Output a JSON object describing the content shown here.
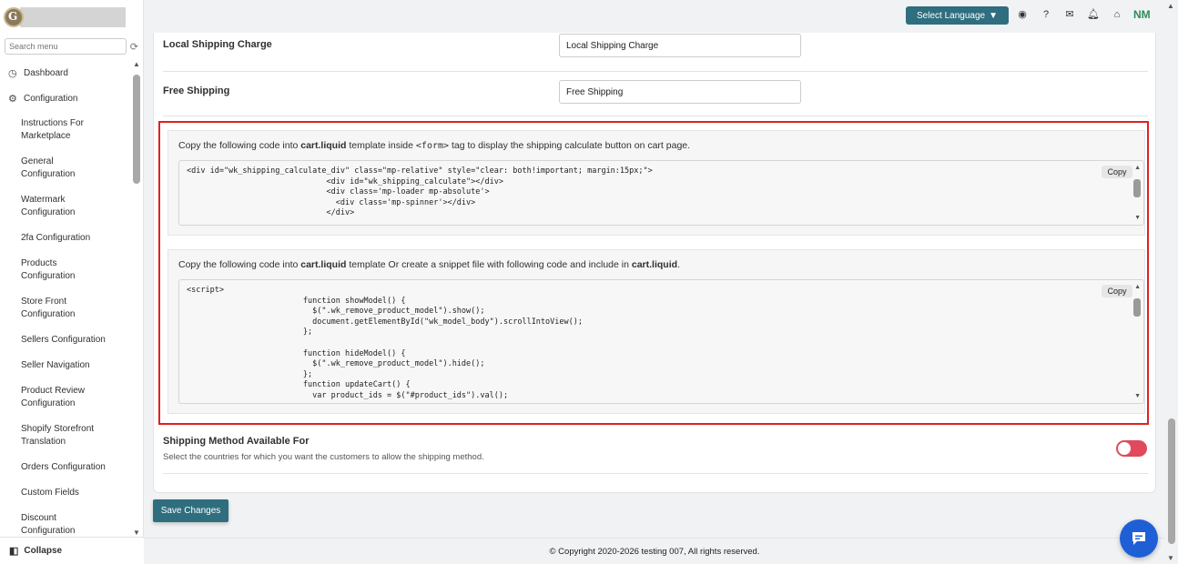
{
  "sidebar": {
    "search_placeholder": "Search menu",
    "top_items": [
      {
        "label": "Dashboard",
        "icon": "dashboard-icon"
      },
      {
        "label": "Configuration",
        "icon": "gear-icon"
      }
    ],
    "sub_items": [
      "Instructions For Marketplace",
      "General Configuration",
      "Watermark Configuration",
      "2fa Configuration",
      "Products Configuration",
      "Store Front Configuration",
      "Sellers Configuration",
      "Seller Navigation",
      "Product Review Configuration",
      "Shopify Storefront Translation",
      "Orders Configuration",
      "Custom Fields",
      "Discount Configuration"
    ],
    "collapse_label": "Collapse"
  },
  "topbar": {
    "language_label": "Select Language",
    "initials": "NM"
  },
  "form": {
    "local_shipping": {
      "label": "Local Shipping Charge",
      "value": "Local Shipping Charge"
    },
    "free_shipping": {
      "label": "Free Shipping",
      "value": "Free Shipping"
    },
    "block1": {
      "desc_pre": "Copy the following code into ",
      "desc_file": "cart.liquid",
      "desc_mid": " template inside ",
      "desc_tag": "<form>",
      "desc_post": " tag to display the shipping calculate button on cart page.",
      "code": "<div id=\"wk_shipping_calculate_div\" class=\"mp-relative\" style=\"clear: both!important; margin:15px;\">\n                              <div id=\"wk_shipping_calculate\"></div>\n                              <div class='mp-loader mp-absolute'>\n                                <div class='mp-spinner'></div>\n                              </div>",
      "copy_label": "Copy"
    },
    "block2": {
      "desc_pre": "Copy the following code into ",
      "desc_file": "cart.liquid",
      "desc_mid": " template Or create a snippet file with following code and include in ",
      "desc_file2": "cart.liquid",
      "desc_post": ".",
      "code": "<script>\n                         function showModel() {\n                           $(\".wk_remove_product_model\").show();\n                           document.getElementById(\"wk_model_body\").scrollIntoView();\n                         };\n\n                         function hideModel() {\n                           $(\".wk_remove_product_model\").hide();\n                         };\n                         function updateCart() {\n                           var product_ids = $(\"#product_ids\").val();",
      "copy_label": "Copy"
    },
    "shipping_method": {
      "title": "Shipping Method Available For",
      "desc": "Select the countries for which you want the customers to allow the shipping method."
    },
    "save_label": "Save Changes"
  },
  "footer": {
    "copyright": "© Copyright 2020-2026 testing 007, All rights reserved."
  },
  "colors": {
    "primary": "#2f6e7e",
    "highlight_border": "#e02020",
    "toggle": "#e04a5c",
    "chat": "#1f5fd6"
  }
}
